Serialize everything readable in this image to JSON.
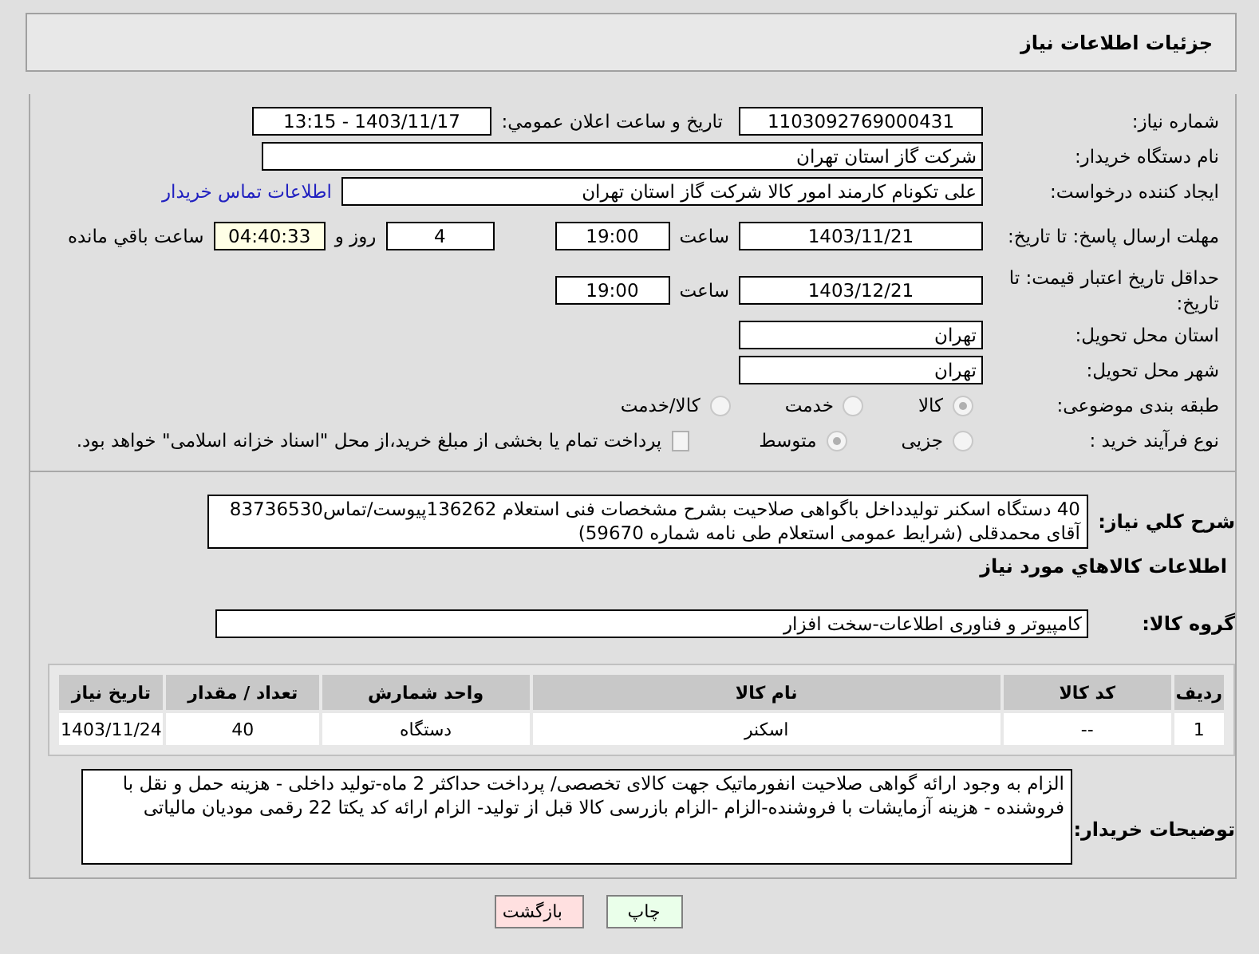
{
  "header": {
    "title": "جزئیات اطلاعات نیاز"
  },
  "need_number": {
    "label": "شماره نیاز:",
    "value": "1103092769000431"
  },
  "announce": {
    "label": "تاریخ و ساعت اعلان عمومي:",
    "value": "1403/11/17 - 13:15"
  },
  "buyer_org": {
    "label": "نام دستگاه خریدار:",
    "value": "شرکت گاز استان تهران"
  },
  "creator": {
    "label": "ایجاد کننده درخواست:",
    "value": "علی تکونام کارمند امور کالا شرکت گاز استان تهران",
    "link": "اطلاعات تماس خریدار"
  },
  "deadline": {
    "label": "مهلت ارسال پاسخ: تا تاریخ:",
    "date": "1403/11/21",
    "time_label": "ساعت",
    "time": "19:00",
    "days": "4",
    "days_label": "روز و",
    "remaining": "04:40:33",
    "remaining_label": "ساعت باقي مانده"
  },
  "validity": {
    "label": "حداقل تاریخ اعتبار قیمت: تا تاریخ:",
    "date": "1403/12/21",
    "time_label": "ساعت",
    "time": "19:00"
  },
  "province": {
    "label": "استان محل تحویل:",
    "value": "تهران"
  },
  "city": {
    "label": "شهر محل تحویل:",
    "value": "تهران"
  },
  "category": {
    "label": "طبقه بندی موضوعی:",
    "options": [
      {
        "label": "کالا",
        "selected": true
      },
      {
        "label": "خدمت",
        "selected": false
      },
      {
        "label": "کالا/خدمت",
        "selected": false
      }
    ]
  },
  "purchase_type": {
    "label": "نوع فرآیند خرید :",
    "options": [
      {
        "label": "جزیی",
        "selected": false
      },
      {
        "label": "متوسط",
        "selected": true
      }
    ],
    "payment": {
      "checked": false,
      "text": "پرداخت تمام یا بخشی از مبلغ خرید،از محل \"اسناد خزانه اسلامی\" خواهد بود."
    }
  },
  "description": {
    "label": "شرح کلي نياز:",
    "text": "40 دستگاه اسکنر تولیدداخل باگواهی صلاحیت بشرح مشخصات فنی استعلام 136262پیوست/تماس83736530 آقای محمدقلی (شرایط عمومی استعلام طی نامه شماره 59670)"
  },
  "goods_heading": "اطلاعات کالاهاي مورد نياز",
  "goods_group": {
    "label": "گروه کالا:",
    "value": "کامپیوتر و فناوری اطلاعات-سخت افزار"
  },
  "table": {
    "columns": [
      "ردیف",
      "کد کالا",
      "نام کالا",
      "واحد شمارش",
      "تعداد / مقدار",
      "تاریخ نیاز"
    ],
    "rows": [
      [
        "1",
        "--",
        "اسکنر",
        "دستگاه",
        "40",
        "1403/11/24"
      ]
    ]
  },
  "buyer_notes": {
    "label": "توضیحات خریدار:",
    "text": "الزام به وجود ارائه گواهی صلاحیت انفورماتیک جهت کالای تخصصی/ پرداخت حداکثر 2 ماه-تولید داخلی - هزینه حمل و نقل با فروشنده - هزینه آزمایشات با فروشنده-الزام  -الزام بازرسی کالا قبل از تولید- الزام ارائه کد یکتا 22 رقمی مودیان مالیاتی"
  },
  "buttons": [
    {
      "label": "چاپ",
      "kind": "print"
    },
    {
      "label": "بازگشت",
      "kind": "back"
    }
  ]
}
